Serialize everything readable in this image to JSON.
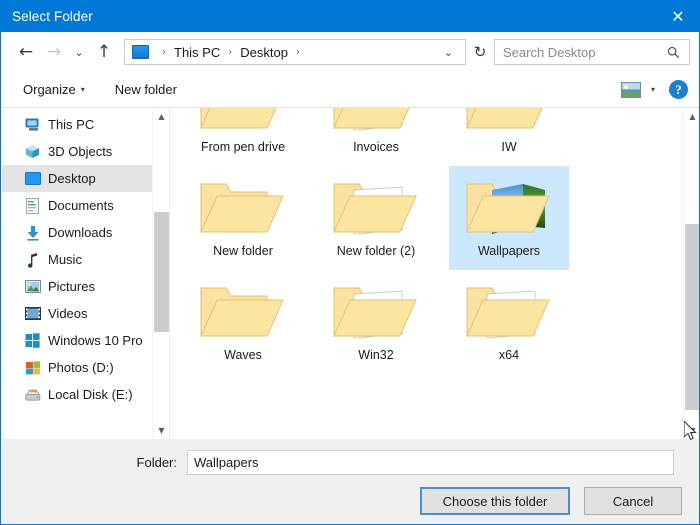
{
  "window": {
    "title": "Select Folder",
    "close_label": "✕"
  },
  "nav": {
    "back_icon": "←",
    "forward_icon": "→",
    "recent_icon": "⌄",
    "up_icon": "↑",
    "breadcrumb_icon": "this-pc-icon",
    "breadcrumbs": [
      "This PC",
      "Desktop"
    ],
    "separator": "›",
    "dropdown_icon": "⌄",
    "refresh_icon": "↻"
  },
  "search": {
    "placeholder": "Search Desktop",
    "icon": "search-icon"
  },
  "toolbar": {
    "organize": "Organize",
    "organize_caret": "▾",
    "new_folder": "New folder",
    "view_caret": "▾",
    "help": "?"
  },
  "sidebar": {
    "items": [
      {
        "label": "This PC",
        "icon": "computer-icon",
        "selected": false
      },
      {
        "label": "3D Objects",
        "icon": "cube-icon",
        "selected": false
      },
      {
        "label": "Desktop",
        "icon": "desktop-icon",
        "selected": true
      },
      {
        "label": "Documents",
        "icon": "documents-icon",
        "selected": false
      },
      {
        "label": "Downloads",
        "icon": "downloads-icon",
        "selected": false
      },
      {
        "label": "Music",
        "icon": "music-icon",
        "selected": false
      },
      {
        "label": "Pictures",
        "icon": "pictures-icon",
        "selected": false
      },
      {
        "label": "Videos",
        "icon": "videos-icon",
        "selected": false
      },
      {
        "label": "Windows 10 Pro",
        "icon": "windows-drive-icon",
        "selected": false
      },
      {
        "label": "Photos (D:)",
        "icon": "drive-icon",
        "selected": false
      },
      {
        "label": "Local Disk (E:)",
        "icon": "local-disk-icon",
        "selected": false
      }
    ]
  },
  "files": {
    "items": [
      {
        "label": "From pen drive",
        "type": "folder",
        "selected": false
      },
      {
        "label": "Invoices",
        "type": "folder-pdf",
        "selected": false
      },
      {
        "label": "IW",
        "type": "folder",
        "selected": false
      },
      {
        "label": "New folder",
        "type": "folder",
        "selected": false
      },
      {
        "label": "New folder (2)",
        "type": "folder-pdf",
        "selected": false
      },
      {
        "label": "Wallpapers",
        "type": "folder-images",
        "selected": true
      },
      {
        "label": "Waves",
        "type": "folder",
        "selected": false
      },
      {
        "label": "Win32",
        "type": "folder-disc",
        "selected": false
      },
      {
        "label": "x64",
        "type": "folder-disc",
        "selected": false
      }
    ]
  },
  "footer": {
    "folder_label": "Folder:",
    "folder_value": "Wallpapers",
    "choose_button": "Choose this folder",
    "cancel_button": "Cancel"
  },
  "colors": {
    "accent": "#0078d7",
    "selection": "#cce8ff",
    "tree_selection": "#e4e4e4",
    "folder": "#fce5a0"
  }
}
